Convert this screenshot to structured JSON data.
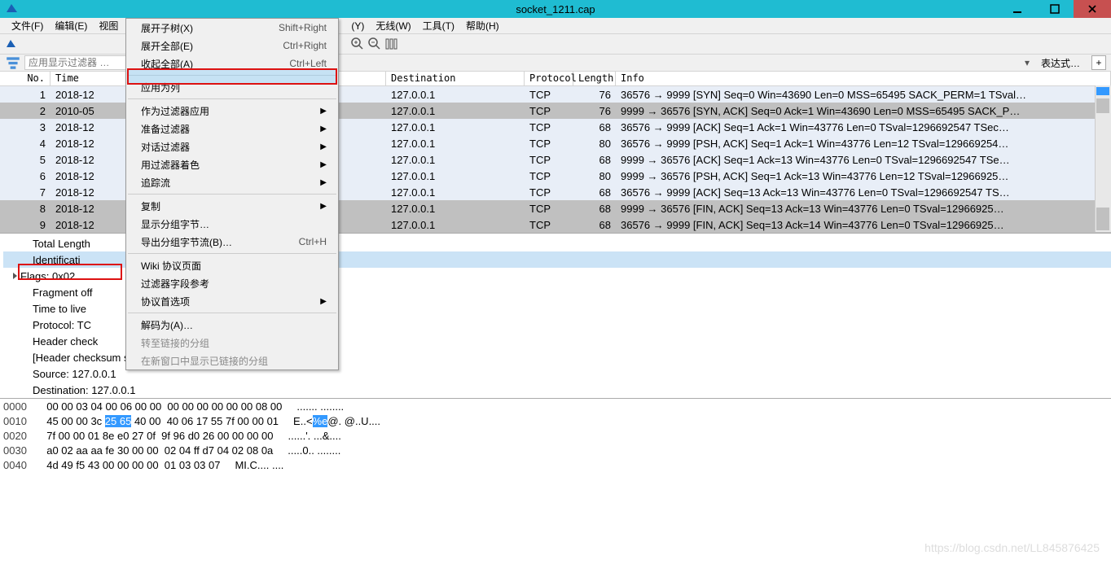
{
  "window": {
    "title": "socket_1211.cap"
  },
  "menubar": [
    "文件(F)",
    "编辑(E)",
    "视图",
    "",
    "(Y)",
    "无线(W)",
    "工具(T)",
    "帮助(H)"
  ],
  "filter": {
    "placeholder": "应用显示过滤器 …",
    "expression": "表达式…"
  },
  "columns": {
    "no": "No.",
    "time": "Time",
    "src": "",
    "dst": "Destination",
    "proto": "Protocol",
    "len": "Length",
    "info": "Info"
  },
  "packets": [
    {
      "no": "1",
      "time": "2018-12",
      "dst": "127.0.0.1",
      "proto": "TCP",
      "len": "76",
      "info": "36576 → 9999 [SYN] Seq=0 Win=43690 Len=0 MSS=65495 SACK_PERM=1 TSval…",
      "cls": "row-light"
    },
    {
      "no": "2",
      "time": "2010-05",
      "dst": "127.0.0.1",
      "proto": "TCP",
      "len": "76",
      "info": "9999 → 36576 [SYN, ACK] Seq=0 Ack=1 Win=43690 Len=0 MSS=65495 SACK_P…",
      "cls": "row-sel"
    },
    {
      "no": "3",
      "time": "2018-12",
      "dst": "127.0.0.1",
      "proto": "TCP",
      "len": "68",
      "info": "36576 → 9999 [ACK] Seq=1 Ack=1 Win=43776 Len=0 TSval=1296692547 TSec…",
      "cls": "row-light"
    },
    {
      "no": "4",
      "time": "2018-12",
      "dst": "127.0.0.1",
      "proto": "TCP",
      "len": "80",
      "info": "36576 → 9999 [PSH, ACK] Seq=1 Ack=1 Win=43776 Len=12 TSval=129669254…",
      "cls": "row-light"
    },
    {
      "no": "5",
      "time": "2018-12",
      "dst": "127.0.0.1",
      "proto": "TCP",
      "len": "68",
      "info": "9999 → 36576 [ACK] Seq=1 Ack=13 Win=43776 Len=0 TSval=1296692547 TSe…",
      "cls": "row-light"
    },
    {
      "no": "6",
      "time": "2018-12",
      "dst": "127.0.0.1",
      "proto": "TCP",
      "len": "80",
      "info": "9999 → 36576 [PSH, ACK] Seq=1 Ack=13 Win=43776 Len=12 TSval=12966925…",
      "cls": "row-light"
    },
    {
      "no": "7",
      "time": "2018-12",
      "dst": "127.0.0.1",
      "proto": "TCP",
      "len": "68",
      "info": "36576 → 9999 [ACK] Seq=13 Ack=13 Win=43776 Len=0 TSval=1296692547 TS…",
      "cls": "row-light"
    },
    {
      "no": "8",
      "time": "2018-12",
      "dst": "127.0.0.1",
      "proto": "TCP",
      "len": "68",
      "info": "9999 → 36576 [FIN, ACK] Seq=13 Ack=13 Win=43776 Len=0 TSval=12966925…",
      "cls": "row-gray"
    },
    {
      "no": "9",
      "time": "2018-12",
      "dst": "127.0.0.1",
      "proto": "TCP",
      "len": "68",
      "info": "36576 → 9999 [FIN, ACK] Seq=13 Ack=14 Win=43776 Len=0 TSval=12966925…",
      "cls": "row-gray"
    }
  ],
  "details": [
    "Total Length",
    "Identificati",
    "Flags: 0x02",
    "Fragment off",
    "Time to live",
    "Protocol: TC",
    "Header check",
    "[Header checksum status: Unverified]",
    "Source: 127.0.0.1",
    "Destination: 127.0.0.1"
  ],
  "hex": [
    {
      "off": "0000",
      "b": "00 00 03 04 00 06 00 00  00 00 00 00 00 00 08 00",
      "a": "....... ........"
    },
    {
      "off": "0010",
      "b": "45 00 00 3c ",
      "bh": "25 65",
      "b2": " 40 00  40 06 17 55 7f 00 00 01",
      "a": "E..<",
      "ah": "%e",
      "a2": "@. @..U...."
    },
    {
      "off": "0020",
      "b": "7f 00 00 01 8e e0 27 0f  9f 96 d0 26 00 00 00 00",
      "a": "......'. ...&...."
    },
    {
      "off": "0030",
      "b": "a0 02 aa aa fe 30 00 00  02 04 ff d7 04 02 08 0a",
      "a": ".....0.. ........"
    },
    {
      "off": "0040",
      "b": "4d 49 f5 43 00 00 00 00  01 03 03 07",
      "a": "MI.C.... ...."
    }
  ],
  "ctx": {
    "expand_sub": {
      "label": "展开子树(X)",
      "key": "Shift+Right"
    },
    "expand_all": {
      "label": "展开全部(E)",
      "key": "Ctrl+Right"
    },
    "collapse_all": {
      "label": "收起全部(A)",
      "key": "Ctrl+Left"
    },
    "apply_col": {
      "label": "应用为列"
    },
    "as_filter": {
      "label": "作为过滤器应用"
    },
    "prep_filter": {
      "label": "准备过滤器"
    },
    "conv_filter": {
      "label": "对话过滤器"
    },
    "color_filter": {
      "label": "用过滤器着色"
    },
    "follow": {
      "label": "追踪流"
    },
    "copy": {
      "label": "复制"
    },
    "show_bytes": {
      "label": "显示分组字节…"
    },
    "export_bytes": {
      "label": "导出分组字节流(B)…",
      "key": "Ctrl+H"
    },
    "wiki": {
      "label": "Wiki 协议页面"
    },
    "filter_ref": {
      "label": "过滤器字段参考"
    },
    "proto_pref": {
      "label": "协议首选项"
    },
    "decode_as": {
      "label": "解码为(A)…"
    },
    "goto_linked": {
      "label": "转至链接的分组"
    },
    "new_window": {
      "label": "在新窗口中显示已链接的分组"
    }
  },
  "watermark": "https://blog.csdn.net/LL845876425"
}
